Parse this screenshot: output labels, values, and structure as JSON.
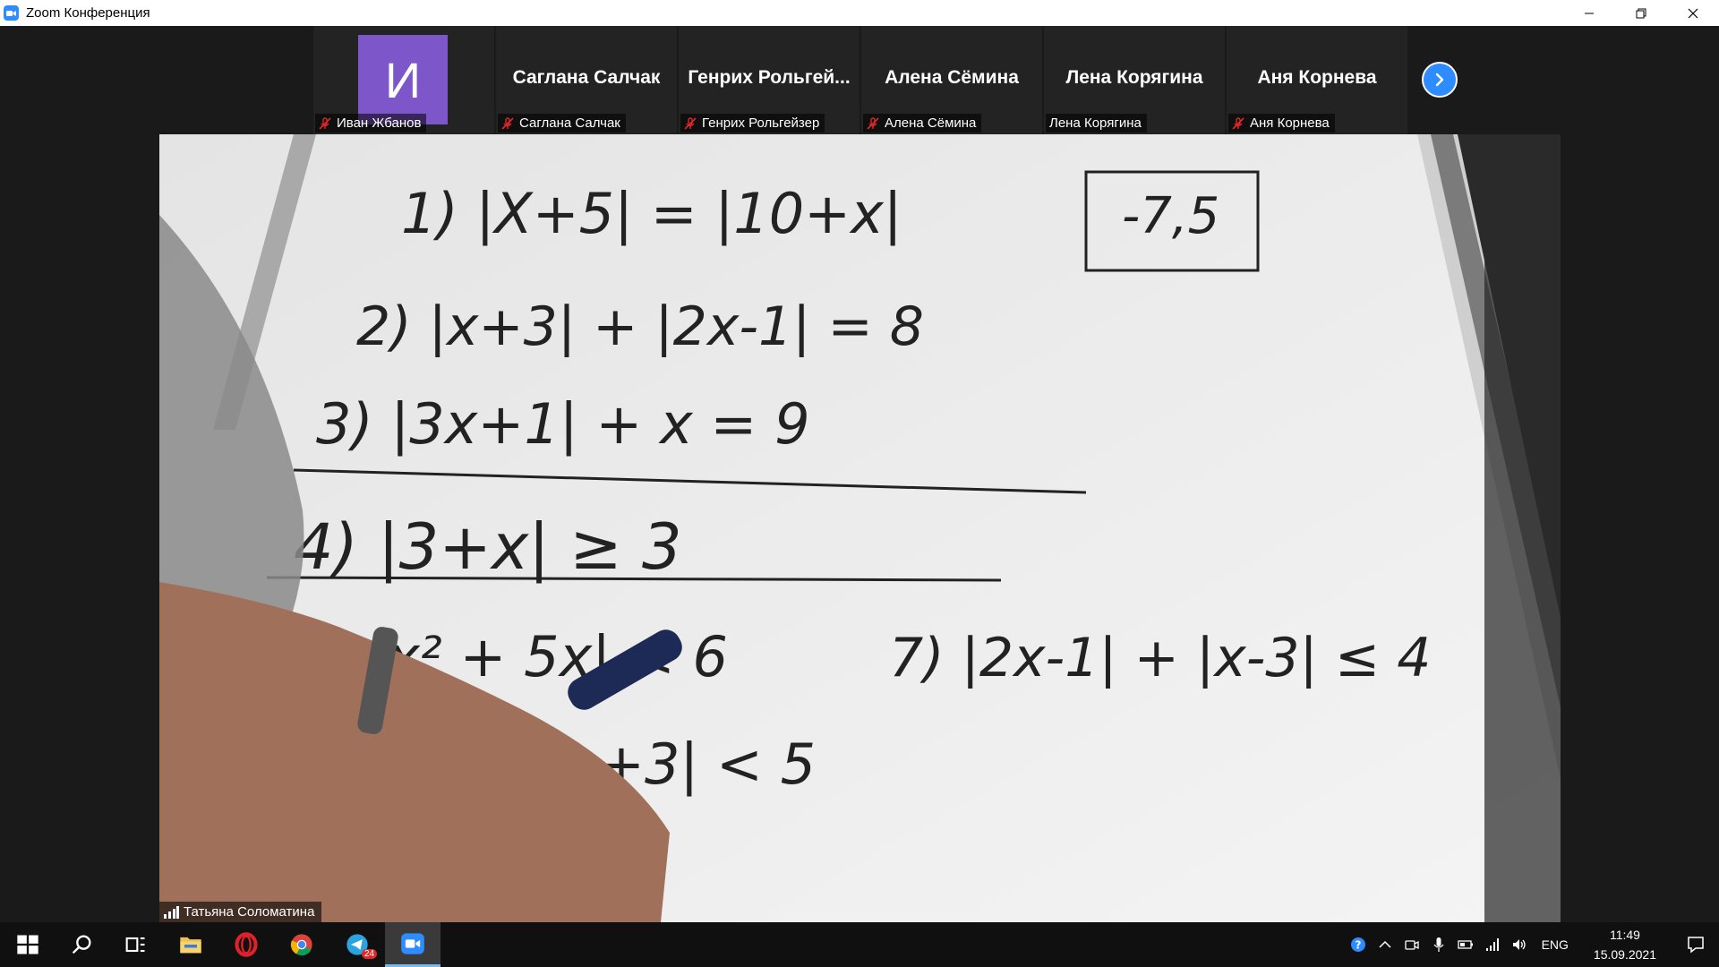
{
  "window": {
    "title": "Zoom Конференция"
  },
  "gallery": {
    "participants": [
      {
        "tile_text": "",
        "avatar_letter": "И",
        "label": "Иван Жбанов",
        "muted": true
      },
      {
        "tile_text": "Саглана Салчак",
        "label": "Саглана Салчак",
        "muted": true
      },
      {
        "tile_text": "Генрих Рольгей...",
        "label": "Генрих Рольгейзер",
        "muted": true
      },
      {
        "tile_text": "Алена Сёмина",
        "label": "Алена Сёмина",
        "muted": true
      },
      {
        "tile_text": "Лена Корягина",
        "label": "Лена Корягина",
        "muted": false
      },
      {
        "tile_text": "Аня Корнева",
        "label": "Аня Корнева",
        "muted": true
      }
    ],
    "next_icon": "chevron-right-icon"
  },
  "speaker": {
    "name": "Татьяна Соломатина"
  },
  "board": {
    "lines": [
      "1) |X+5| = |10+x|",
      "-7,5",
      "2) |x+3| + |2x-1| = 8",
      "3) |3x+1| + x = 9",
      "4) |3+x| ≥ 3",
      "5) |x² + 5x| < 6",
      "7) |2x-1| + |x-3| ≤ 4",
      "+3| < 5"
    ]
  },
  "taskbar": {
    "telegram_badge": "24",
    "language": "ENG",
    "time": "11:49",
    "date": "15.09.2021"
  },
  "colors": {
    "zoom_blue": "#2d8cff",
    "avatar_purple": "#7d56c9",
    "muted_red": "#e02828"
  }
}
